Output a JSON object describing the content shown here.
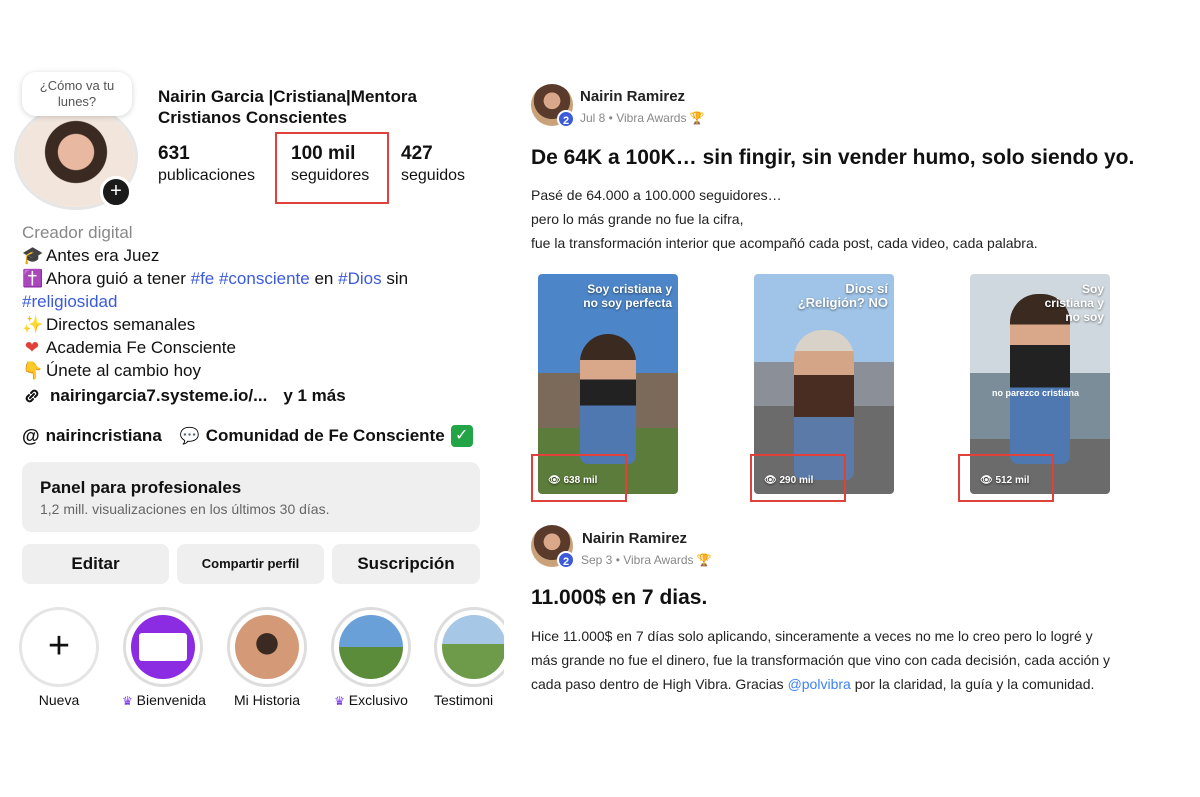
{
  "profile": {
    "note": "¿Cómo va tu lunes?",
    "name_line1": "Nairin Garcia |Cristiana|Mentora",
    "name_line2": "Cristianos Conscientes",
    "stats": [
      {
        "num": "631",
        "label": "publicaciones"
      },
      {
        "num": "100 mil",
        "label": "seguidores"
      },
      {
        "num": "427",
        "label": "seguidos"
      }
    ],
    "bio": {
      "category": "Creador digital",
      "line1": "Antes era Juez",
      "line2_a": "Ahora guió a tener",
      "line2_tags": "#fe #consciente",
      "line2_b": "en",
      "line2_tag2": "#Dios",
      "line2_c": "sin",
      "line3_tag": "#religiosidad",
      "line4": "Directos semanales",
      "line5": "Academia Fe Consciente",
      "line6": "Únete al cambio hoy"
    },
    "link": "nairingarcia7.systeme.io/...",
    "link_more": "y 1 más",
    "threads_handle": "nairincristiana",
    "community": "Comunidad de Fe Consciente",
    "panel_title": "Panel para profesionales",
    "panel_sub": "1,2 mill. visualizaciones en los últimos 30 días.",
    "buttons": {
      "edit": "Editar",
      "share": "Compartir perfil",
      "subscribe": "Suscripción"
    },
    "highlights": [
      "Nueva",
      "Bienvenida",
      "Mi Historia",
      "Exclusivo",
      "Testimoni"
    ]
  },
  "post1": {
    "author": "Nairin Ramirez",
    "badge": "2",
    "meta": "Jul 8 • Vibra Awards",
    "headline": "De 64K a 100K… sin fingir, sin vender humo, solo siendo yo.",
    "body": [
      "Pasé de 64.000 a 100.000 seguidores…",
      "pero lo más grande no fue la cifra,",
      "fue la transformación interior que acompañó cada post, cada video, cada palabra."
    ],
    "reels": [
      {
        "caption": "Soy cristiana y no soy perfecta",
        "views": "638 mil"
      },
      {
        "caption": "Dios sí ¿Religión? NO",
        "views": "290 mil"
      },
      {
        "caption": "Soy cristiana y no soy",
        "views": "512 mil",
        "overlay": "no parezco cristiana"
      }
    ]
  },
  "post2": {
    "author": "Nairin Ramirez",
    "badge": "2",
    "meta": "Sep 3 • Vibra Awards",
    "headline": "11.000$ en 7 dias.",
    "body_line1": "Hice 11.000$ en 7 días solo aplicando, sinceramente a veces no me lo creo pero lo logré y",
    "body_line2": "más grande no fue el dinero, fue la transformación que vino con cada decisión, cada acción y",
    "body_line3_a": "cada paso dentro de High Vibra. Gracias",
    "body_mention": "@polvibra",
    "body_line3_b": "por la claridad, la guía y la comunidad."
  },
  "colors": {
    "highlight_box": "#e0413a",
    "hashtag": "#3b5bdb",
    "mention": "#3b82f6",
    "panel_bg": "#efefef"
  }
}
